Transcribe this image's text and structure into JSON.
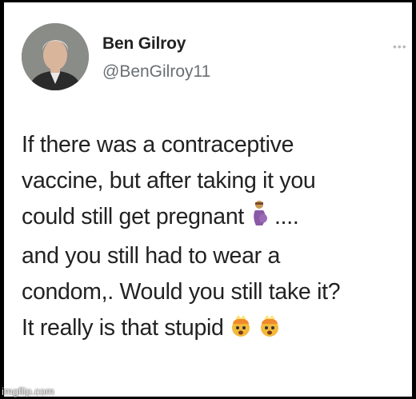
{
  "post": {
    "author_name": "Ben Gilroy",
    "author_handle": "@BenGilroy11",
    "more_icon": "more-dots-icon",
    "lines": [
      "If there was a contraceptive",
      "vaccine, but after taking it you",
      "could still get pregnant",
      "and you still had to wear a",
      "condom,. Would you still take it?",
      "It really is that stupid"
    ],
    "line3_suffix": "....",
    "emojis": {
      "pregnant": "pregnant-woman-emoji",
      "exploding": "exploding-head-emoji"
    }
  },
  "watermark": "imgflip.com",
  "colors": {
    "background": "#000000",
    "card": "#ffffff",
    "text": "#222222",
    "handle": "#6b6f73"
  }
}
